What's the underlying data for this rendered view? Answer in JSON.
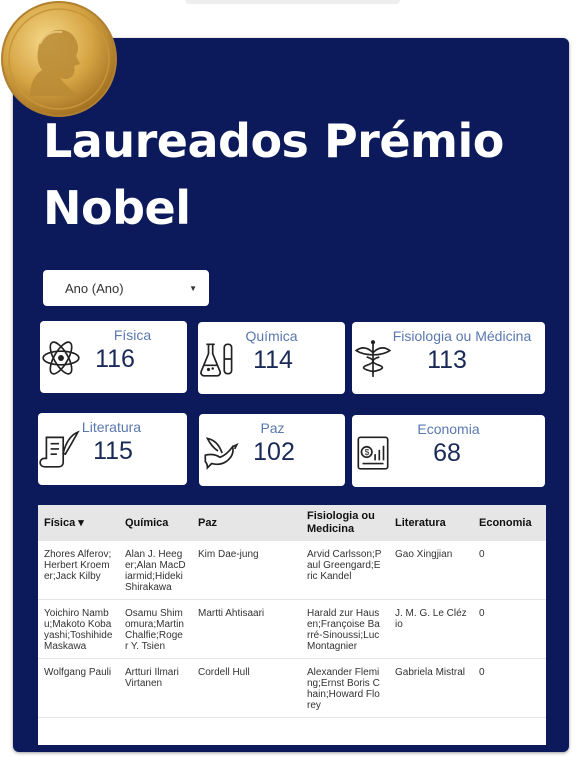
{
  "page": {
    "title": "Laureados Prémio Nobel"
  },
  "filter": {
    "label": "Ano (Ano)"
  },
  "cards": [
    {
      "label": "Física",
      "value": "116",
      "icon": "atom-icon"
    },
    {
      "label": "Química",
      "value": "114",
      "icon": "chemistry-flask-icon"
    },
    {
      "label": "Fisiologia ou Médicina",
      "value": "113",
      "icon": "caduceus-icon"
    },
    {
      "label": "Literatura",
      "value": "115",
      "icon": "scroll-quill-icon"
    },
    {
      "label": "Paz",
      "value": "102",
      "icon": "dove-icon"
    },
    {
      "label": "Economia",
      "value": "68",
      "icon": "economy-chart-icon"
    }
  ],
  "table": {
    "headers": [
      "Física",
      "Química",
      "Paz",
      "Fisiologia ou Medicina",
      "Literatura",
      "Economia"
    ],
    "sort_indicator": "▾",
    "rows": [
      [
        "Zhores Alferov;Herbert Kroemer;Jack Kilby",
        "Alan J. Heeger;Alan MacDiarmid;Hideki Shirakawa",
        "Kim Dae-jung",
        "Arvid Carlsson;Paul Greengard;Eric Kandel",
        "Gao Xingjian",
        "0"
      ],
      [
        "Yoichiro Nambu;Makoto Kobayashi;Toshihide Maskawa",
        "Osamu Shimomura;Martin Chalfie;Roger Y. Tsien",
        "Martti Ahtisaari",
        "Harald zur Hausen;Françoise Barré-Sinoussi;Luc Montagnier",
        "J. M. G. Le Clézio",
        "0"
      ],
      [
        "Wolfgang Pauli",
        "Artturi Ilmari Virtanen",
        "Cordell Hull",
        "Alexander Fleming;Ernst Boris Chain;Howard Florey",
        "Gabriela Mistral",
        "0"
      ]
    ]
  },
  "colors": {
    "panel": "#0c1a5c",
    "card_label": "#5a78b0",
    "card_value": "#1a2a57"
  }
}
